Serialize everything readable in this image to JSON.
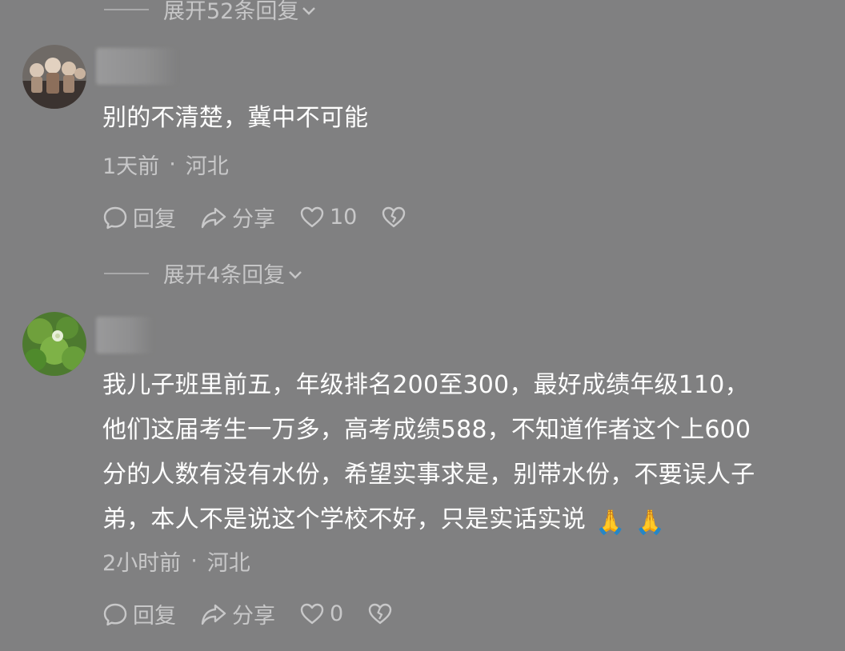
{
  "thread": {
    "top_expand_label": "展开52条回复",
    "comments": [
      {
        "text": "别的不清楚，冀中不可能",
        "time": "1天前",
        "separator": "·",
        "location": "河北",
        "reply_label": "回复",
        "share_label": "分享",
        "like_count": "10",
        "expand_label": "展开4条回复"
      },
      {
        "text_lines": [
          "我儿子班里前五，年级排名200至300，最好成绩年级110，",
          "他们这届考生一万多，高考成绩588，不知道作者这个上600",
          "分的人数有没有水份，希望实事求是，别带水份，不要误人子",
          "弟，本人不是说这个学校不好，只是实话实说"
        ],
        "emojis": [
          "🙏",
          "🙏"
        ],
        "time": "2小时前",
        "separator": "·",
        "location": "河北",
        "reply_label": "回复",
        "share_label": "分享",
        "like_count": "0"
      }
    ]
  },
  "icons": {
    "reply": "comment-bubble-icon",
    "share": "share-arrow-icon",
    "like": "heart-icon",
    "dislike": "broken-heart-icon",
    "expand": "chevron-down-icon"
  },
  "colors": {
    "background": "#808081",
    "text_primary": "#ffffff",
    "text_secondary": "#c8c8c9"
  }
}
